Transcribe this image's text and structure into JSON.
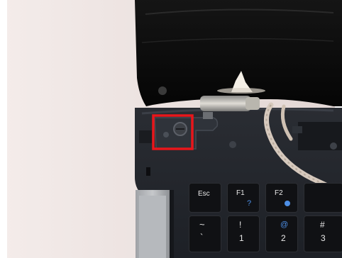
{
  "photo": {
    "subject": "laptop-disassembly-hinge-screw",
    "highlight_color": "#e8161b"
  },
  "keyboard": {
    "keys": [
      {
        "main": "Esc",
        "sub": ""
      },
      {
        "main": "F1",
        "sub": "?"
      },
      {
        "main": "F2",
        "sub": ""
      },
      {
        "main": "~",
        "sub": "`"
      },
      {
        "main": "!",
        "sub": "1"
      },
      {
        "main": "@",
        "sub": "2"
      },
      {
        "main": "#",
        "sub": "3"
      }
    ]
  }
}
